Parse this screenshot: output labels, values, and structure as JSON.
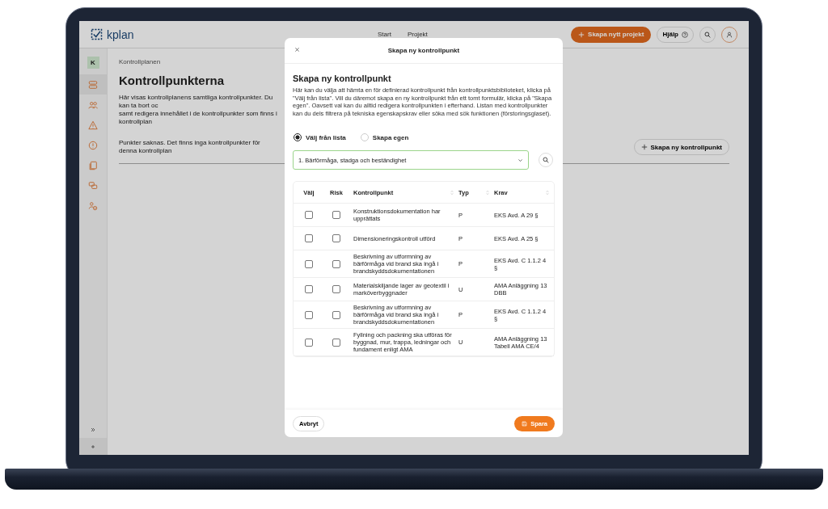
{
  "app": {
    "logo": "kplan",
    "nav": [
      "Start",
      "Projekt"
    ],
    "create_project": "Skapa nytt projekt",
    "help": "Hjälp"
  },
  "sidebar": {
    "project_badge": "K",
    "items": [
      {
        "kind": "layers",
        "selected": true
      },
      {
        "kind": "people",
        "selected": false
      },
      {
        "kind": "warning",
        "selected": false
      },
      {
        "kind": "info",
        "selected": false
      },
      {
        "kind": "documents",
        "selected": false
      },
      {
        "kind": "chat",
        "selected": false
      },
      {
        "kind": "user-check",
        "selected": false
      }
    ],
    "bottom": [
      {
        "kind": "expand"
      },
      {
        "kind": "add"
      }
    ]
  },
  "page": {
    "breadcrumb": "Kontrollplanen",
    "title": "Kontrollpunkterna",
    "description": [
      "Här visas kontrollplanens samtliga kontrollpunkter. Du kan ta bort oc",
      "samt redigera innehållet i de kontrollpunkter som finns i kontrollplan"
    ],
    "empty": "Punkter saknas. Det finns inga kontrollpunkter för denna kontrollplan",
    "add_button": "Skapa ny kontrollpunkt"
  },
  "modal": {
    "title": "Skapa ny kontrollpunkt",
    "heading": "Skapa ny kontrollpunkt",
    "text": "Här kan du välja att hämta en för definierad kontrollpunkt från kontrollpunktsbiblioteket, klicka på \"Välj från lista\". Vill du däremot skapa en ny kontrollpunkt från ett tomt formulär, klicka på \"Skapa egen\". Oavsett val kan du alltid redigera kontrollpunkten i efterhand. Listan med kontrollpunkter kan du dels filtrera på tekniska egenskapskrav eller söka med sök funktionen (förstoringsglaset).",
    "options": [
      {
        "label": "Välj från lista",
        "selected": true
      },
      {
        "label": "Skapa egen",
        "selected": false
      }
    ],
    "select": "1. Bärförmåga, stadga och beständighet",
    "columns": [
      {
        "label": "Välj",
        "sortable": false
      },
      {
        "label": "Risk",
        "sortable": false
      },
      {
        "label": "Kontrollpunkt",
        "sortable": true
      },
      {
        "label": "Typ",
        "sortable": true
      },
      {
        "label": "Krav",
        "sortable": true
      }
    ],
    "rows": [
      {
        "valj": false,
        "risk": false,
        "kontrollpunkt": "Konstruktionsdokumentation har upprättats",
        "typ": "P",
        "krav": "EKS Avd. A 29 §"
      },
      {
        "valj": false,
        "risk": false,
        "kontrollpunkt": "Dimensioneringskontroll utförd",
        "typ": "P",
        "krav": "EKS Avd. A 25 §"
      },
      {
        "valj": false,
        "risk": false,
        "kontrollpunkt": "Beskrivning av utformning av bärförmåga vid brand ska ingå i brandskyddsdokumentationen",
        "typ": "P",
        "krav": "EKS Avd. C 1.1.2 4 §"
      },
      {
        "valj": false,
        "risk": false,
        "kontrollpunkt": "Materialskiljande lager av geotextil i marköverbyggnader",
        "typ": "U",
        "krav": "AMA Anläggning 13 DBB"
      },
      {
        "valj": false,
        "risk": false,
        "kontrollpunkt": "Beskrivning av utformning av bärförmåga vid brand ska ingå i brandskyddsdokumentationen",
        "typ": "P",
        "krav": "EKS Avd. C 1.1.2 4 §"
      },
      {
        "valj": false,
        "risk": false,
        "kontrollpunkt": "Fyllning och packning ska utföras för byggnad, mur, trappa, ledningar och fundament enligt AMA",
        "typ": "U",
        "krav": "AMA Anläggning 13 Tabell AMA CE/4"
      }
    ],
    "cancel": "Avbryt",
    "save": "Spara"
  }
}
